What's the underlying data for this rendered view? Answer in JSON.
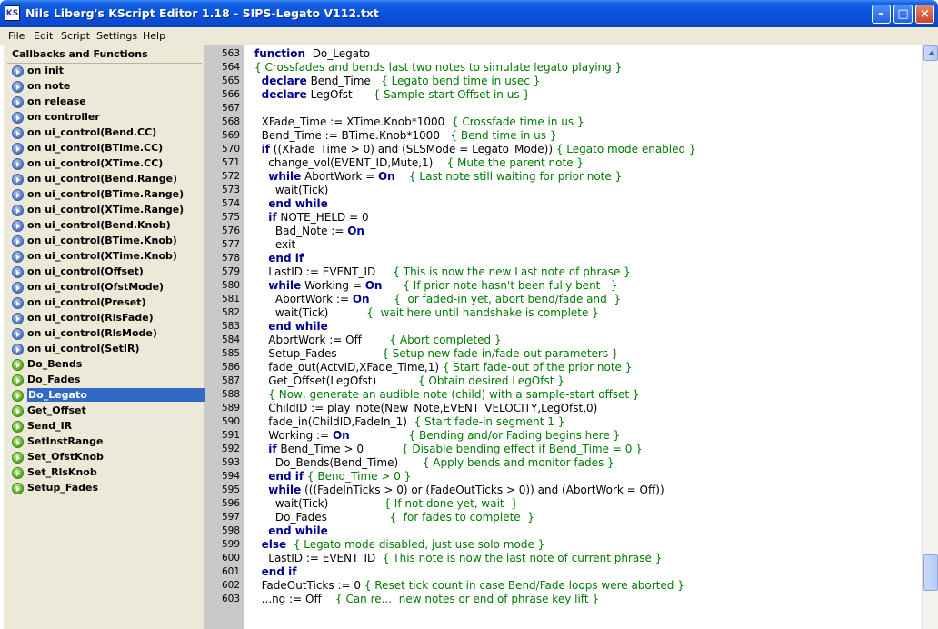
{
  "window": {
    "title": "Nils Liberg's KScript Editor 1.18 - SIPS-Legato V112.txt",
    "icon_label": "KS",
    "minimize_glyph": "–",
    "maximize_glyph": "□",
    "close_glyph": "×"
  },
  "menu": {
    "items": [
      "File",
      "Edit",
      "Script",
      "Settings",
      "Help"
    ]
  },
  "sidebar": {
    "header": "Callbacks and Functions",
    "items": [
      {
        "label": "on init",
        "kind": "callback"
      },
      {
        "label": "on note",
        "kind": "callback"
      },
      {
        "label": "on release",
        "kind": "callback"
      },
      {
        "label": "on controller",
        "kind": "callback"
      },
      {
        "label": "on ui_control(Bend.CC)",
        "kind": "callback"
      },
      {
        "label": "on ui_control(BTime.CC)",
        "kind": "callback"
      },
      {
        "label": "on ui_control(XTime.CC)",
        "kind": "callback"
      },
      {
        "label": "on ui_control(Bend.Range)",
        "kind": "callback"
      },
      {
        "label": "on ui_control(BTime.Range)",
        "kind": "callback"
      },
      {
        "label": "on ui_control(XTime.Range)",
        "kind": "callback"
      },
      {
        "label": "on ui_control(Bend.Knob)",
        "kind": "callback"
      },
      {
        "label": "on ui_control(BTime.Knob)",
        "kind": "callback"
      },
      {
        "label": "on ui_control(XTime.Knob)",
        "kind": "callback"
      },
      {
        "label": "on ui_control(Offset)",
        "kind": "callback"
      },
      {
        "label": "on ui_control(OfstMode)",
        "kind": "callback"
      },
      {
        "label": "on ui_control(Preset)",
        "kind": "callback"
      },
      {
        "label": "on ui_control(RlsFade)",
        "kind": "callback"
      },
      {
        "label": "on ui_control(RlsMode)",
        "kind": "callback"
      },
      {
        "label": "on ui_control(SetIR)",
        "kind": "callback"
      },
      {
        "label": "Do_Bends",
        "kind": "function"
      },
      {
        "label": "Do_Fades",
        "kind": "function"
      },
      {
        "label": "Do_Legato",
        "kind": "function",
        "selected": true
      },
      {
        "label": "Get_Offset",
        "kind": "function"
      },
      {
        "label": "Send_IR",
        "kind": "function"
      },
      {
        "label": "SetInstRange",
        "kind": "function"
      },
      {
        "label": "Set_OfstKnob",
        "kind": "function"
      },
      {
        "label": "Set_RlsKnob",
        "kind": "function"
      },
      {
        "label": "Setup_Fades",
        "kind": "function"
      }
    ]
  },
  "editor": {
    "lines": [
      {
        "n": "563",
        "t": [
          [
            "kw",
            "function"
          ],
          [
            "",
            "  Do_Legato"
          ]
        ]
      },
      {
        "n": "564",
        "t": [
          [
            "cm",
            "{ Crossfades and bends last two notes to simulate legato playing }"
          ]
        ]
      },
      {
        "n": "565",
        "t": [
          [
            "",
            "  "
          ],
          [
            "kw",
            "declare"
          ],
          [
            "",
            " Bend_Time   "
          ],
          [
            "cm",
            "{ Legato bend time in usec }"
          ]
        ]
      },
      {
        "n": "566",
        "t": [
          [
            "",
            "  "
          ],
          [
            "kw",
            "declare"
          ],
          [
            "",
            " LegOfst      "
          ],
          [
            "cm",
            "{ Sample-start Offset in us }"
          ]
        ]
      },
      {
        "n": "567",
        "t": [
          [
            "",
            ""
          ]
        ]
      },
      {
        "n": "568",
        "t": [
          [
            "",
            "  XFade_Time := XTime.Knob*1000  "
          ],
          [
            "cm",
            "{ Crossfade time in us }"
          ]
        ]
      },
      {
        "n": "569",
        "t": [
          [
            "",
            "  Bend_Time := BTime.Knob*1000   "
          ],
          [
            "cm",
            "{ Bend time in us }"
          ]
        ]
      },
      {
        "n": "570",
        "t": [
          [
            "",
            "  "
          ],
          [
            "kw",
            "if"
          ],
          [
            "",
            " ((XFade_Time > 0) and (SLSMode = Legato_Mode)) "
          ],
          [
            "cm",
            "{ Legato mode enabled }"
          ]
        ]
      },
      {
        "n": "571",
        "t": [
          [
            "",
            "    change_vol(EVENT_ID,Mute,1)    "
          ],
          [
            "cm",
            "{ Mute the parent note }"
          ]
        ]
      },
      {
        "n": "572",
        "t": [
          [
            "",
            "    "
          ],
          [
            "kw",
            "while"
          ],
          [
            "",
            " AbortWork = "
          ],
          [
            "kw",
            "On"
          ],
          [
            "",
            "    "
          ],
          [
            "cm",
            "{ Last note still waiting for prior note }"
          ]
        ]
      },
      {
        "n": "573",
        "t": [
          [
            "",
            "      wait(Tick)"
          ]
        ]
      },
      {
        "n": "574",
        "t": [
          [
            "",
            "    "
          ],
          [
            "kw",
            "end while"
          ]
        ]
      },
      {
        "n": "575",
        "t": [
          [
            "",
            "    "
          ],
          [
            "kw",
            "if"
          ],
          [
            "",
            " NOTE_HELD = 0"
          ]
        ]
      },
      {
        "n": "576",
        "t": [
          [
            "",
            "      Bad_Note := "
          ],
          [
            "kw",
            "On"
          ]
        ]
      },
      {
        "n": "577",
        "t": [
          [
            "",
            "      exit"
          ]
        ]
      },
      {
        "n": "578",
        "t": [
          [
            "",
            "    "
          ],
          [
            "kw",
            "end if"
          ]
        ]
      },
      {
        "n": "579",
        "t": [
          [
            "",
            "    LastID := EVENT_ID     "
          ],
          [
            "cm",
            "{ This is now the new Last note of phrase }"
          ]
        ]
      },
      {
        "n": "580",
        "t": [
          [
            "",
            "    "
          ],
          [
            "kw",
            "while"
          ],
          [
            "",
            " Working = "
          ],
          [
            "kw",
            "On"
          ],
          [
            "",
            "      "
          ],
          [
            "cm",
            "{ If prior note hasn't been fully bent   }"
          ]
        ]
      },
      {
        "n": "581",
        "t": [
          [
            "",
            "      AbortWork := "
          ],
          [
            "kw",
            "On"
          ],
          [
            "",
            "       "
          ],
          [
            "cm",
            "{  or faded-in yet, abort bend/fade and  }"
          ]
        ]
      },
      {
        "n": "582",
        "t": [
          [
            "",
            "      wait(Tick)           "
          ],
          [
            "cm",
            "{  wait here until handshake is complete }"
          ]
        ]
      },
      {
        "n": "583",
        "t": [
          [
            "",
            "    "
          ],
          [
            "kw",
            "end while"
          ]
        ]
      },
      {
        "n": "584",
        "t": [
          [
            "",
            "    AbortWork := Off        "
          ],
          [
            "cm",
            "{ Abort completed }"
          ]
        ]
      },
      {
        "n": "585",
        "t": [
          [
            "",
            "    Setup_Fades             "
          ],
          [
            "cm",
            "{ Setup new fade-in/fade-out parameters }"
          ]
        ]
      },
      {
        "n": "586",
        "t": [
          [
            "",
            "    fade_out(ActvID,XFade_Time,1) "
          ],
          [
            "cm",
            "{ Start fade-out of the prior note }"
          ]
        ]
      },
      {
        "n": "587",
        "t": [
          [
            "",
            "    Get_Offset(LegOfst)            "
          ],
          [
            "cm",
            "{ Obtain desired LegOfst }"
          ]
        ]
      },
      {
        "n": "588",
        "t": [
          [
            "",
            "    "
          ],
          [
            "cm",
            "{ Now, generate an audible note (child) with a sample-start offset }"
          ]
        ]
      },
      {
        "n": "589",
        "t": [
          [
            "",
            "    ChildID := play_note(New_Note,EVENT_VELOCITY,LegOfst,0)"
          ]
        ]
      },
      {
        "n": "590",
        "t": [
          [
            "",
            "    fade_in(ChildID,FadeIn_1)  "
          ],
          [
            "cm",
            "{ Start fade-in segment 1 }"
          ]
        ]
      },
      {
        "n": "591",
        "t": [
          [
            "",
            "    Working := "
          ],
          [
            "kw",
            "On"
          ],
          [
            "",
            "                 "
          ],
          [
            "cm",
            "{ Bending and/or Fading begins here }"
          ]
        ]
      },
      {
        "n": "592",
        "t": [
          [
            "",
            "    "
          ],
          [
            "kw",
            "if"
          ],
          [
            "",
            " Bend_Time > 0           "
          ],
          [
            "cm",
            "{ Disable bending effect if Bend_Time = 0 }"
          ]
        ]
      },
      {
        "n": "593",
        "t": [
          [
            "",
            "      Do_Bends(Bend_Time)       "
          ],
          [
            "cm",
            "{ Apply bends and monitor fades }"
          ]
        ]
      },
      {
        "n": "594",
        "t": [
          [
            "",
            "    "
          ],
          [
            "kw",
            "end if"
          ],
          [
            "",
            " "
          ],
          [
            "cm",
            "{ Bend_Time > 0 }"
          ]
        ]
      },
      {
        "n": "595",
        "t": [
          [
            "",
            "    "
          ],
          [
            "kw",
            "while"
          ],
          [
            "",
            " (((FadeInTicks > 0) or (FadeOutTicks > 0)) and (AbortWork = Off))"
          ]
        ]
      },
      {
        "n": "596",
        "t": [
          [
            "",
            "      wait(Tick)                "
          ],
          [
            "cm",
            "{ If not done yet, wait  }"
          ]
        ]
      },
      {
        "n": "597",
        "t": [
          [
            "",
            "      Do_Fades                  "
          ],
          [
            "cm",
            "{  for fades to complete  }"
          ]
        ]
      },
      {
        "n": "598",
        "t": [
          [
            "",
            "    "
          ],
          [
            "kw",
            "end while"
          ]
        ]
      },
      {
        "n": "599",
        "t": [
          [
            "",
            "  "
          ],
          [
            "kw",
            "else"
          ],
          [
            "",
            "  "
          ],
          [
            "cm",
            "{ Legato mode disabled, just use solo mode }"
          ]
        ]
      },
      {
        "n": "600",
        "t": [
          [
            "",
            "    LastID := EVENT_ID  "
          ],
          [
            "cm",
            "{ This note is now the last note of current phrase }"
          ]
        ]
      },
      {
        "n": "601",
        "t": [
          [
            "",
            "  "
          ],
          [
            "kw",
            "end if"
          ]
        ]
      },
      {
        "n": "602",
        "t": [
          [
            "",
            "  FadeOutTicks := 0 "
          ],
          [
            "cm",
            "{ Reset tick count in case Bend/Fade loops were aborted }"
          ]
        ]
      },
      {
        "n": "603",
        "t": [
          [
            "",
            "  ...ng := Off    "
          ],
          [
            "cm",
            "{ Can re...  new notes or end of phrase key lift }"
          ]
        ]
      }
    ]
  }
}
